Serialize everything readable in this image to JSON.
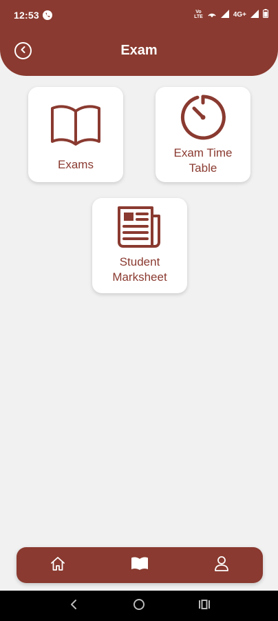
{
  "status_bar": {
    "time": "12:53",
    "volte_top": "Vo",
    "volte_bottom": "LTE",
    "network": "4G+"
  },
  "header": {
    "title": "Exam"
  },
  "tiles": [
    {
      "label": "Exams",
      "icon": "open-book-icon"
    },
    {
      "label": "Exam Time Table",
      "icon": "timer-icon"
    },
    {
      "label": "Student Marksheet",
      "icon": "newspaper-icon"
    }
  ],
  "bottom_nav": {
    "items": [
      {
        "icon": "home-icon"
      },
      {
        "icon": "book-icon"
      },
      {
        "icon": "user-icon"
      }
    ]
  },
  "colors": {
    "primary": "#8a3a30",
    "background": "#f1f1f1",
    "tile": "#ffffff"
  }
}
